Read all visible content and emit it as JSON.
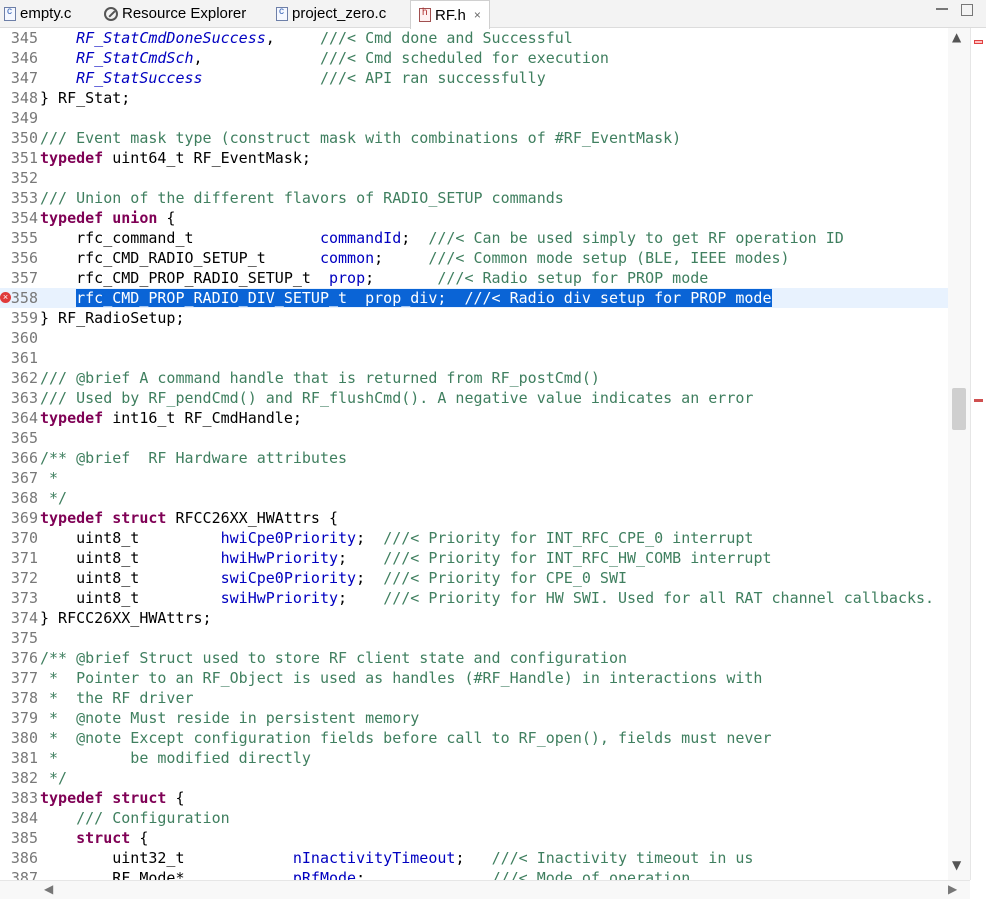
{
  "tabs": [
    {
      "label": "empty.c",
      "icon": "c-file-icon"
    },
    {
      "label": "Resource Explorer",
      "icon": "resource-explorer-icon"
    },
    {
      "label": "project_zero.c",
      "icon": "c-file-icon"
    },
    {
      "label": "RF.h",
      "icon": "h-file-icon",
      "active": true,
      "close": "×"
    }
  ],
  "lines": [
    {
      "n": "345",
      "parts": [
        {
          "t": "    "
        },
        {
          "c": "enm",
          "t": "RF_StatCmdDoneSuccess"
        },
        {
          "t": ",     "
        },
        {
          "c": "cm",
          "t": "///< Cmd done and Successful"
        }
      ]
    },
    {
      "n": "346",
      "parts": [
        {
          "t": "    "
        },
        {
          "c": "enm",
          "t": "RF_StatCmdSch"
        },
        {
          "t": ",             "
        },
        {
          "c": "cm",
          "t": "///< Cmd scheduled for execution"
        }
      ]
    },
    {
      "n": "347",
      "parts": [
        {
          "t": "    "
        },
        {
          "c": "enm",
          "t": "RF_StatSuccess"
        },
        {
          "t": "             "
        },
        {
          "c": "cm",
          "t": "///< API ran successfully"
        }
      ]
    },
    {
      "n": "348",
      "parts": [
        {
          "t": "} RF_Stat;"
        }
      ]
    },
    {
      "n": "349",
      "parts": [
        {
          "t": ""
        }
      ]
    },
    {
      "n": "350",
      "parts": [
        {
          "c": "cm",
          "t": "/// Event mask type (construct mask with combinations of #RF_EventMask)"
        }
      ]
    },
    {
      "n": "351",
      "parts": [
        {
          "c": "kw",
          "t": "typedef"
        },
        {
          "t": " uint64_t RF_EventMask;"
        }
      ]
    },
    {
      "n": "352",
      "parts": [
        {
          "t": ""
        }
      ]
    },
    {
      "n": "353",
      "parts": [
        {
          "c": "cm",
          "t": "/// Union of the different flavors of RADIO_SETUP commands"
        }
      ]
    },
    {
      "n": "354",
      "parts": [
        {
          "c": "kw",
          "t": "typedef"
        },
        {
          "t": " "
        },
        {
          "c": "kw",
          "t": "union"
        },
        {
          "t": " {"
        }
      ]
    },
    {
      "n": "355",
      "parts": [
        {
          "t": "    rfc_command_t              "
        },
        {
          "c": "fld",
          "t": "commandId"
        },
        {
          "t": ";  "
        },
        {
          "c": "cm",
          "t": "///< Can be used simply to get RF operation ID"
        }
      ]
    },
    {
      "n": "356",
      "parts": [
        {
          "t": "    rfc_CMD_RADIO_SETUP_t      "
        },
        {
          "c": "fld",
          "t": "common"
        },
        {
          "t": ";     "
        },
        {
          "c": "cm",
          "t": "///< Common mode setup (BLE, IEEE modes)"
        }
      ]
    },
    {
      "n": "357",
      "parts": [
        {
          "t": "    rfc_CMD_PROP_RADIO_SETUP_t  "
        },
        {
          "c": "fld",
          "t": "prop"
        },
        {
          "t": ";       "
        },
        {
          "c": "cm",
          "t": "///< Radio setup for PROP mode"
        }
      ]
    },
    {
      "n": "358",
      "err": true,
      "highlight": true,
      "parts": [
        {
          "t": "    "
        },
        {
          "c": "sel",
          "t": "rfc_CMD_PROP_RADIO_DIV_SETUP_t  prop_div;  ///< Radio div setup for PROP mode"
        }
      ]
    },
    {
      "n": "359",
      "parts": [
        {
          "t": "} RF_RadioSetup;"
        }
      ]
    },
    {
      "n": "360",
      "parts": [
        {
          "t": ""
        }
      ]
    },
    {
      "n": "361",
      "parts": [
        {
          "t": ""
        }
      ]
    },
    {
      "n": "362",
      "parts": [
        {
          "c": "cm",
          "t": "/// @brief A command handle that is returned from RF_postCmd()"
        }
      ]
    },
    {
      "n": "363",
      "parts": [
        {
          "c": "cm",
          "t": "/// Used by RF_pendCmd() and RF_flushCmd(). A negative value indicates an error"
        }
      ]
    },
    {
      "n": "364",
      "parts": [
        {
          "c": "kw",
          "t": "typedef"
        },
        {
          "t": " int16_t RF_CmdHandle;"
        }
      ]
    },
    {
      "n": "365",
      "parts": [
        {
          "t": ""
        }
      ]
    },
    {
      "n": "366",
      "parts": [
        {
          "c": "cm",
          "t": "/** @brief  RF Hardware attributes"
        }
      ]
    },
    {
      "n": "367",
      "parts": [
        {
          "c": "cm",
          "t": " *"
        }
      ]
    },
    {
      "n": "368",
      "parts": [
        {
          "c": "cm",
          "t": " */"
        }
      ]
    },
    {
      "n": "369",
      "parts": [
        {
          "c": "kw",
          "t": "typedef"
        },
        {
          "t": " "
        },
        {
          "c": "kw",
          "t": "struct"
        },
        {
          "t": " RFCC26XX_HWAttrs {"
        }
      ]
    },
    {
      "n": "370",
      "parts": [
        {
          "t": "    uint8_t         "
        },
        {
          "c": "fld",
          "t": "hwiCpe0Priority"
        },
        {
          "t": ";  "
        },
        {
          "c": "cm",
          "t": "///< Priority for INT_RFC_CPE_0 interrupt"
        }
      ]
    },
    {
      "n": "371",
      "parts": [
        {
          "t": "    uint8_t         "
        },
        {
          "c": "fld",
          "t": "hwiHwPriority"
        },
        {
          "t": ";    "
        },
        {
          "c": "cm",
          "t": "///< Priority for INT_RFC_HW_COMB interrupt"
        }
      ]
    },
    {
      "n": "372",
      "parts": [
        {
          "t": "    uint8_t         "
        },
        {
          "c": "fld",
          "t": "swiCpe0Priority"
        },
        {
          "t": ";  "
        },
        {
          "c": "cm",
          "t": "///< Priority for CPE_0 SWI"
        }
      ]
    },
    {
      "n": "373",
      "parts": [
        {
          "t": "    uint8_t         "
        },
        {
          "c": "fld",
          "t": "swiHwPriority"
        },
        {
          "t": ";    "
        },
        {
          "c": "cm",
          "t": "///< Priority for HW SWI. Used for all RAT channel callbacks."
        }
      ]
    },
    {
      "n": "374",
      "parts": [
        {
          "t": "} RFCC26XX_HWAttrs;"
        }
      ]
    },
    {
      "n": "375",
      "parts": [
        {
          "t": ""
        }
      ]
    },
    {
      "n": "376",
      "parts": [
        {
          "c": "cm",
          "t": "/** @brief Struct used to store RF client state and configuration"
        }
      ]
    },
    {
      "n": "377",
      "parts": [
        {
          "c": "cm",
          "t": " *  Pointer to an RF_Object is used as handles (#RF_Handle) in interactions with"
        }
      ]
    },
    {
      "n": "378",
      "parts": [
        {
          "c": "cm",
          "t": " *  the RF driver"
        }
      ]
    },
    {
      "n": "379",
      "parts": [
        {
          "c": "cm",
          "t": " *  @note Must reside in persistent memory"
        }
      ]
    },
    {
      "n": "380",
      "parts": [
        {
          "c": "cm",
          "t": " *  @note Except configuration fields before call to RF_open(), fields must never"
        }
      ]
    },
    {
      "n": "381",
      "parts": [
        {
          "c": "cm",
          "t": " *        be modified directly"
        }
      ]
    },
    {
      "n": "382",
      "parts": [
        {
          "c": "cm",
          "t": " */"
        }
      ]
    },
    {
      "n": "383",
      "parts": [
        {
          "c": "kw",
          "t": "typedef"
        },
        {
          "t": " "
        },
        {
          "c": "kw",
          "t": "struct"
        },
        {
          "t": " {"
        }
      ]
    },
    {
      "n": "384",
      "parts": [
        {
          "t": "    "
        },
        {
          "c": "cm",
          "t": "/// Configuration"
        }
      ]
    },
    {
      "n": "385",
      "parts": [
        {
          "t": "    "
        },
        {
          "c": "kw",
          "t": "struct"
        },
        {
          "t": " {"
        }
      ]
    },
    {
      "n": "386",
      "parts": [
        {
          "t": "        uint32_t            "
        },
        {
          "c": "fld",
          "t": "nInactivityTimeout"
        },
        {
          "t": ";   "
        },
        {
          "c": "cm",
          "t": "///< Inactivity timeout in us"
        }
      ]
    },
    {
      "n": "387",
      "parts": [
        {
          "t": "        RF_Mode*            "
        },
        {
          "c": "fld",
          "t": "pRfMode"
        },
        {
          "t": ";              "
        },
        {
          "c": "cm",
          "t": "///< Mode of operation"
        }
      ]
    }
  ]
}
